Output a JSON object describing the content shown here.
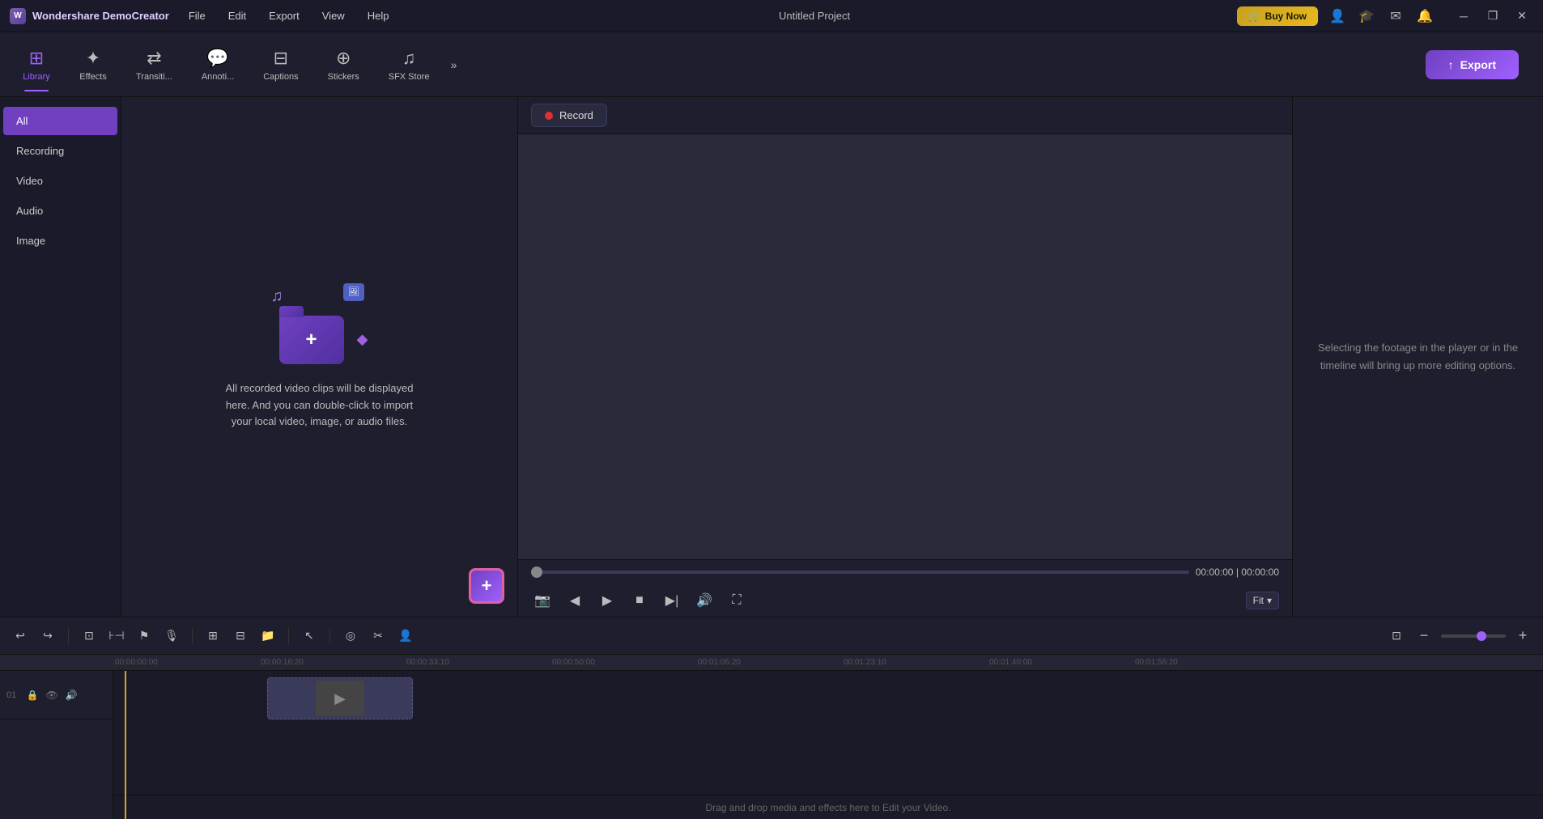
{
  "app": {
    "name": "Wondershare DemoCreator",
    "project_title": "Untitled Project"
  },
  "title_bar": {
    "menu_items": [
      "File",
      "Edit",
      "Export",
      "View",
      "Help"
    ],
    "buy_now_label": "Buy Now",
    "window_controls": [
      "─",
      "❐",
      "✕"
    ]
  },
  "toolbar": {
    "items": [
      {
        "id": "library",
        "label": "Library",
        "icon": "⊞"
      },
      {
        "id": "effects",
        "label": "Effects",
        "icon": "✦"
      },
      {
        "id": "transitions",
        "label": "Transiti...",
        "icon": "▶◀"
      },
      {
        "id": "annotations",
        "label": "Annoti...",
        "icon": "💬"
      },
      {
        "id": "captions",
        "label": "Captions",
        "icon": "⊟"
      },
      {
        "id": "stickers",
        "label": "Stickers",
        "icon": "⊕"
      },
      {
        "id": "sfx",
        "label": "SFX Store",
        "icon": "♫"
      }
    ],
    "more_icon": "»",
    "export_label": "Export"
  },
  "sidebar": {
    "items": [
      {
        "id": "all",
        "label": "All",
        "active": true
      },
      {
        "id": "recording",
        "label": "Recording"
      },
      {
        "id": "video",
        "label": "Video"
      },
      {
        "id": "audio",
        "label": "Audio"
      },
      {
        "id": "image",
        "label": "Image"
      }
    ]
  },
  "media_area": {
    "empty_text": "All recorded video clips will be displayed here. And you can double-click to import your local video, image, or audio files.",
    "add_button_label": "+"
  },
  "preview": {
    "record_button": "Record",
    "time_current": "00:00:00",
    "time_separator": "|",
    "time_total": "00:00:00",
    "fit_label": "Fit",
    "info_text": "Selecting the footage in the player or in the timeline will bring up more editing options."
  },
  "timeline": {
    "ruler_marks": [
      "00:00:00:00",
      "00:00:16:20",
      "00:00:33:10",
      "00:00:50:00",
      "00:01:06:20",
      "00:01:23:10",
      "00:01:40:00",
      "00:01:56:20"
    ],
    "drop_hint": "Drag and drop media and effects here to Edit your Video.",
    "track_number": "01",
    "zoom_minus": "−",
    "zoom_plus": "+"
  }
}
